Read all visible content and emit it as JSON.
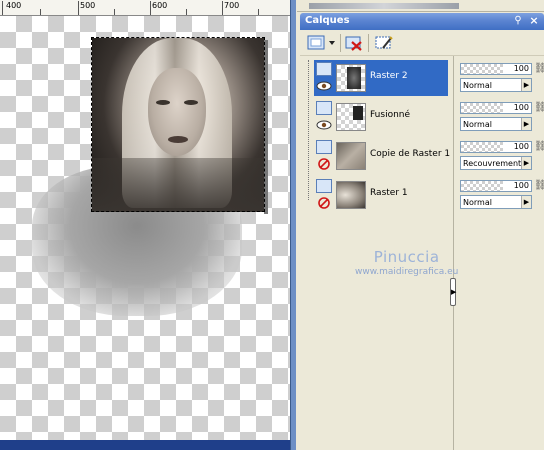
{
  "ruler": {
    "labels": [
      "400",
      "500",
      "600",
      "700"
    ]
  },
  "palette": {
    "title": "Calques",
    "pin_glyph": "⚲",
    "close_glyph": "×"
  },
  "toolbar": {
    "new_layer_icon": "new-raster-layer-icon",
    "delete_icon": "delete-layer-icon",
    "properties_icon": "layer-properties-icon"
  },
  "layers": [
    {
      "name": "Raster 2",
      "visible": true,
      "selected": true,
      "opacity": "100",
      "mode": "Normal"
    },
    {
      "name": "Fusionné",
      "visible": true,
      "selected": false,
      "opacity": "100",
      "mode": "Normal"
    },
    {
      "name": "Copie de Raster 1",
      "visible": false,
      "selected": false,
      "opacity": "100",
      "mode": "Recouvrement"
    },
    {
      "name": "Raster 1",
      "visible": false,
      "selected": false,
      "opacity": "100",
      "mode": "Normal"
    }
  ],
  "watermark": {
    "name": "Pinuccia",
    "url": "www.maidiregrafica.eu"
  },
  "colors": {
    "selection": "#316ac5",
    "titlebar": "#3f6fc4",
    "panel_bg": "#ece9d8"
  }
}
